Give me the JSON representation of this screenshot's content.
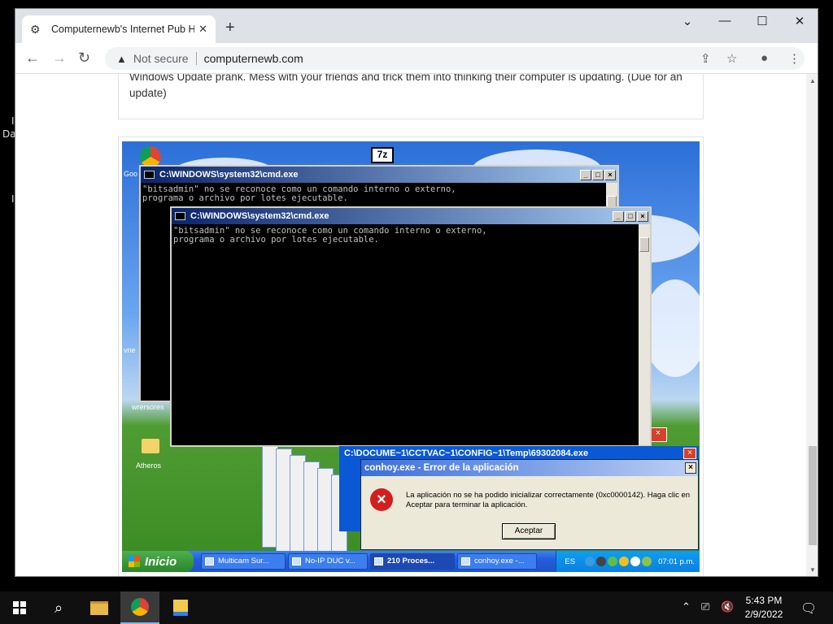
{
  "desktop": {
    "left_fragment_1": "I",
    "left_fragment_2": "Da",
    "left_fragment_3": "I"
  },
  "browser": {
    "tab_title": "Computernewb's Internet Pub H",
    "new_tab": "+",
    "window_controls": {
      "dropdown": "⌄",
      "minimize": "—",
      "maximize": "☐",
      "close": "✕"
    },
    "nav": {
      "back": "←",
      "forward": "→",
      "reload": "↻"
    },
    "omnibox": {
      "security_label": "Not secure",
      "url": "computernewb.com"
    }
  },
  "page": {
    "card_text": "Windows Update prank. Mess with your friends and trick them into thinking their computer is updating. (Due for an update)"
  },
  "xp_screen": {
    "desktop_icons": [
      "Goo",
      "wrersores",
      "Atheros",
      "7z",
      "vne"
    ],
    "cmd_back": {
      "title": "C:\\WINDOWS\\system32\\cmd.exe",
      "output": "\"bitsadmin\" no se reconoce como un comando interno o externo,\nprograma o archivo por lotes ejecutable."
    },
    "cmd_front": {
      "title": "C:\\WINDOWS\\system32\\cmd.exe",
      "output": "\"bitsadmin\" no se reconoce como un comando interno o externo,\nprograma o archivo por lotes ejecutable."
    },
    "error_back_title": "C:\\DOCUME~1\\CCTVAC~1\\CONFIG~1\\Temp\\69302084.exe",
    "error_dialog": {
      "title": "conhoy.exe - Error de la aplicación",
      "message": "La aplicación no se ha podido inicializar correctamente (0xc0000142). Haga clic en Aceptar para terminar la aplicación.",
      "ok_label": "Aceptar"
    },
    "taskbar": {
      "start_label": "Inicio",
      "buttons": [
        "Multicam Sur...",
        "No-IP DUC v...",
        "210 Proces...",
        "conhoy.exe -..."
      ],
      "language": "ES",
      "time": "07:01 p.m."
    }
  },
  "win_taskbar": {
    "time": "5:43 PM",
    "date": "2/9/2022"
  }
}
